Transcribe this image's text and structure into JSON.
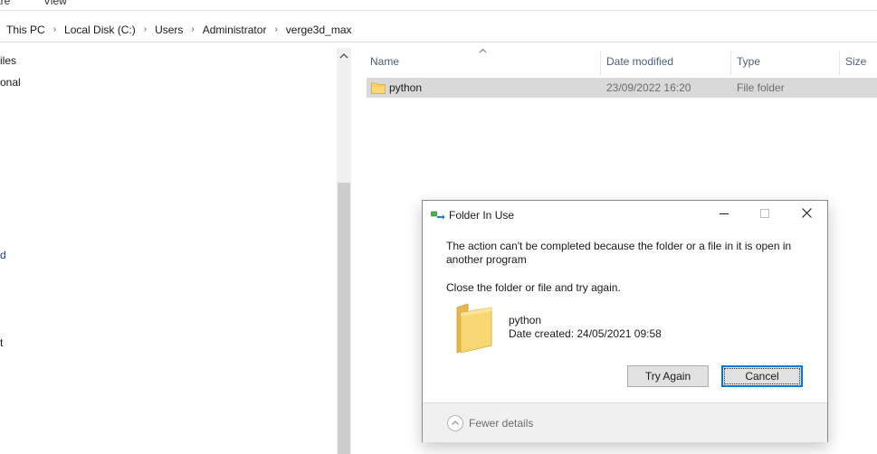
{
  "ribbon": {
    "tabs": [
      "are",
      "View"
    ]
  },
  "breadcrumb": [
    "This PC",
    "Local Disk (C:)",
    "Users",
    "Administrator",
    "verge3d_max"
  ],
  "navpane": {
    "items": [
      {
        "label": "iles"
      },
      {
        "label": "onal"
      },
      {
        "label": "d"
      },
      {
        "label": "t"
      }
    ]
  },
  "filelist": {
    "columns": [
      "Name",
      "Date modified",
      "Type",
      "Size"
    ],
    "rows": [
      {
        "name": "python",
        "date_modified": "23/09/2022 16:20",
        "type": "File folder",
        "size": ""
      }
    ]
  },
  "dialog": {
    "title": "Folder In Use",
    "message": "The action can't be completed because the folder or a file in it is open in another program",
    "instruction": "Close the folder or file and try again.",
    "item_name": "python",
    "item_date": "Date created: 24/05/2021 09:58",
    "try_again_label": "Try Again",
    "cancel_label": "Cancel",
    "fewer_details_label": "Fewer details"
  },
  "colors": {
    "selected_row": "#d9d9d9",
    "header_text": "#4c607a",
    "focus_blue": "#0078d7",
    "folder_yellow": "#f8d775"
  }
}
